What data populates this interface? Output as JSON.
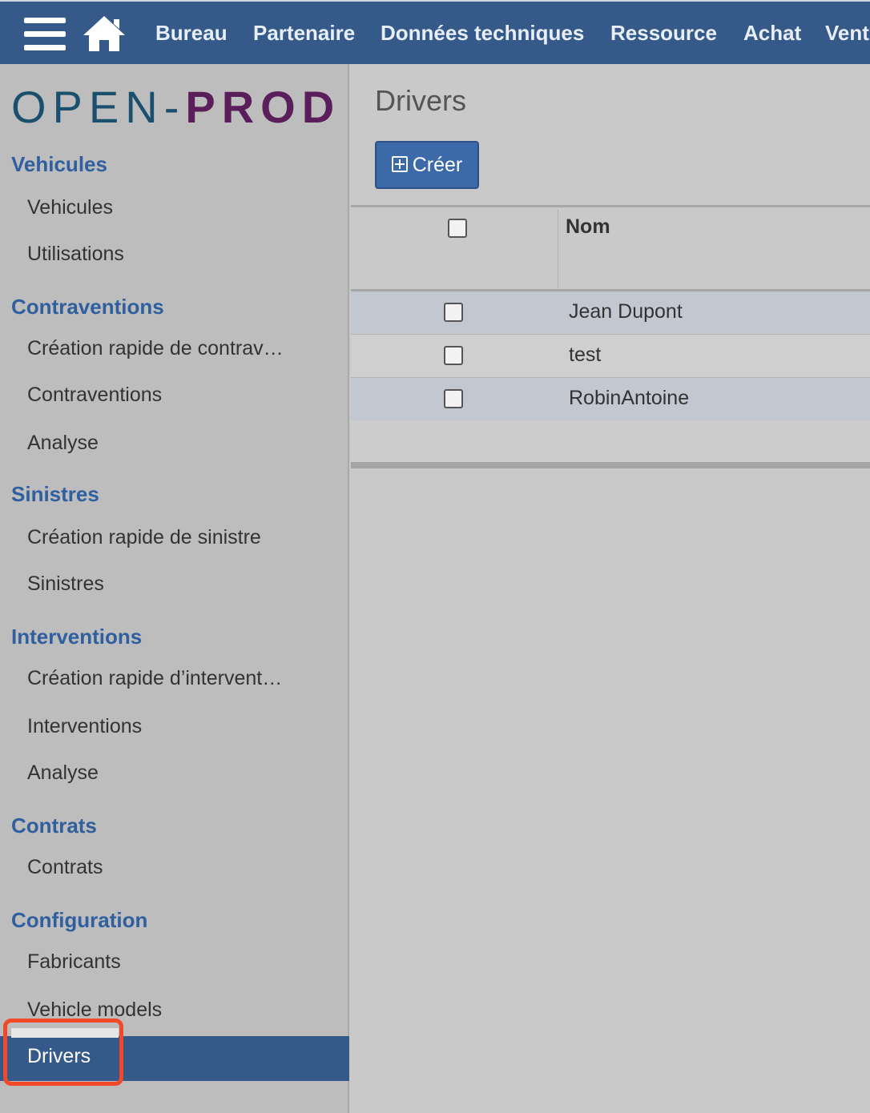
{
  "topbar": {
    "menu": [
      "Bureau",
      "Partenaire",
      "Données techniques",
      "Ressource",
      "Achat",
      "Vent"
    ]
  },
  "logo": {
    "part1": "OPEN-",
    "part2": "PROD"
  },
  "sidebar": {
    "sections": [
      {
        "title": "Vehicules",
        "items": [
          "Vehicules",
          "Utilisations"
        ]
      },
      {
        "title": "Contraventions",
        "items": [
          "Création rapide de contrav…",
          "Contraventions",
          "Analyse"
        ]
      },
      {
        "title": "Sinistres",
        "items": [
          "Création rapide de sinistre",
          "Sinistres"
        ]
      },
      {
        "title": "Interventions",
        "items": [
          "Création rapide d’intervent…",
          "Interventions",
          "Analyse"
        ]
      },
      {
        "title": "Contrats",
        "items": [
          "Contrats"
        ]
      },
      {
        "title": "Configuration",
        "items": [
          "Fabricants",
          "Vehicle models",
          "Drivers"
        ]
      }
    ],
    "active_item": "Drivers"
  },
  "main": {
    "title": "Drivers",
    "create_label": "Créer",
    "columns": [
      "Nom"
    ],
    "rows": [
      {
        "nom": "Jean Dupont"
      },
      {
        "nom": "test"
      },
      {
        "nom": "RobinAntoine"
      }
    ]
  },
  "colors": {
    "topbar": "#355a8a",
    "section_title": "#2f5f9e",
    "active_item_bg": "#355a8a",
    "highlight": "#f04a2a"
  }
}
